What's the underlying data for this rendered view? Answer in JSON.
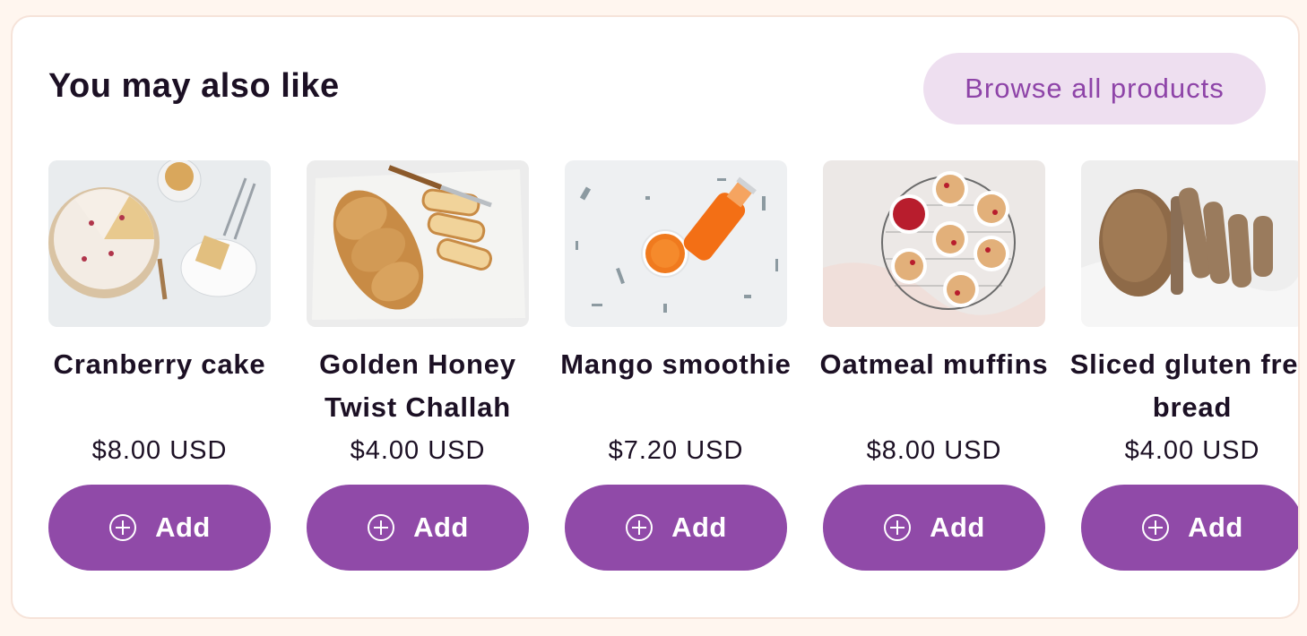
{
  "section": {
    "title": "You may also like",
    "browse_label": "Browse all products"
  },
  "colors": {
    "page_bg": "#fff6ef",
    "accent": "#904aa8",
    "browse_bg": "#eedff0",
    "browse_text": "#8e44a8",
    "text": "#1c1024"
  },
  "products": [
    {
      "name": "Cranberry cake",
      "price": "$8.00 USD",
      "add_label": "Add",
      "image": "cranberry-cake-photo"
    },
    {
      "name": "Golden Honey Twist Challah",
      "price": "$4.00 USD",
      "add_label": "Add",
      "image": "challah-bread-photo"
    },
    {
      "name": "Mango smoothie",
      "price": "$7.20 USD",
      "add_label": "Add",
      "image": "mango-smoothie-photo"
    },
    {
      "name": "Oatmeal muffins",
      "price": "$8.00 USD",
      "add_label": "Add",
      "image": "oatmeal-muffins-photo"
    },
    {
      "name": "Sliced gluten free bread",
      "price": "$4.00 USD",
      "add_label": "Add",
      "image": "gluten-free-bread-photo"
    }
  ]
}
